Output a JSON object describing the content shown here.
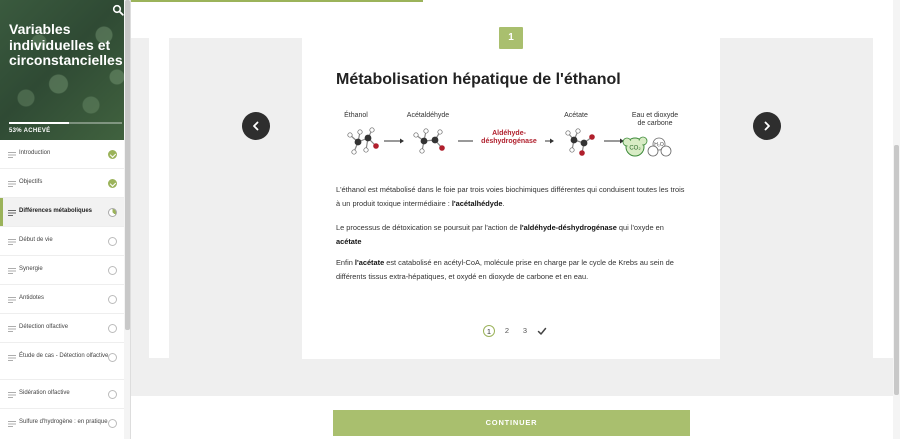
{
  "sidebar": {
    "course_title": "Variables individuelles et circonstancielles",
    "progress_percent": 53,
    "progress_text": "53% ACHEVÉ",
    "items": [
      {
        "label": "Introduction",
        "status": "done"
      },
      {
        "label": "Objectifs",
        "status": "done"
      },
      {
        "label": "Différences métaboliques",
        "status": "in-progress",
        "active": true
      },
      {
        "label": "Début de vie",
        "status": "not-started"
      },
      {
        "label": "Synergie",
        "status": "not-started"
      },
      {
        "label": "Antidotes",
        "status": "not-started"
      },
      {
        "label": "Détection olfactive",
        "status": "not-started"
      },
      {
        "label": "Étude de cas - Détection olfactive",
        "status": "not-started"
      },
      {
        "label": "Sidération olfactive",
        "status": "not-started"
      },
      {
        "label": "Sulfure d'hydrogène : en pratique",
        "status": "not-started"
      }
    ]
  },
  "card": {
    "step_number": "1",
    "title": "Métabolisation hépatique de l'éthanol",
    "diagram": {
      "ethanol": "Éthanol",
      "acetaldehyde": "Acétaldéhyde",
      "enzyme_line1": "Aldéhyde-",
      "enzyme_line2": "déshydrogénase",
      "acetate": "Acétate",
      "end_line1": "Eau et dioxyde",
      "end_line2": "de carbone",
      "co2": "CO₂",
      "h2o": "H₂O"
    },
    "paragraphs": {
      "p1_a": "L'éthanol est métabolisé dans le foie par trois voies biochimiques différentes qui conduisent toutes les trois à un produit toxique intermédiaire : ",
      "p1_b": "l'acétalhédyde",
      "p1_c": ".",
      "p2_a": "Le processus de détoxication se poursuit par l'action de ",
      "p2_b": "l'aldéhyde-déshydrogénase",
      "p2_c": " qui l'oxyde en ",
      "p2_d": "acétate",
      "p3_a": "Enfin ",
      "p3_b": "l'acétate",
      "p3_c": " est catabolisé en acétyl-CoA, molécule prise en charge par le cycle de Krebs au sein de différents tissus extra-hépatiques, et oxydé en dioxyde de carbone et en eau."
    },
    "pager": [
      "1",
      "2",
      "3"
    ]
  },
  "continue_label": "CONTINUER",
  "colors": {
    "accent": "#a9bf6e",
    "enzyme": "#b01f2c",
    "dark": "#2e2e2e"
  }
}
